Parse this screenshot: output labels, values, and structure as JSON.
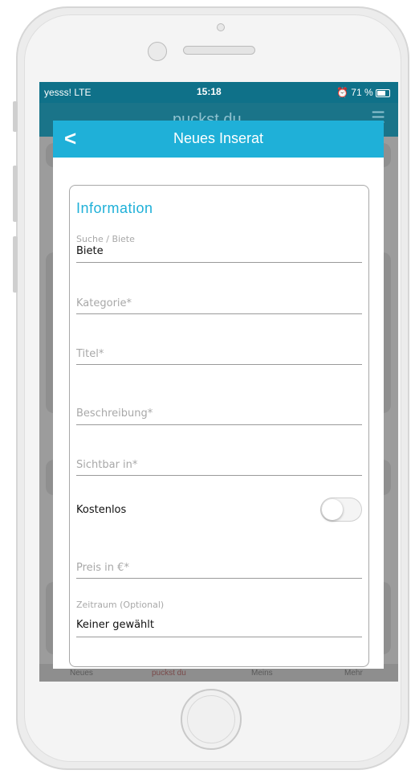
{
  "status_bar": {
    "carrier": "yesss!  LTE",
    "time": "15:18",
    "battery": "71 %"
  },
  "app_bar": {
    "title": "puckst du"
  },
  "modal": {
    "title": "Neues Inserat",
    "section_title": "Information",
    "fields": {
      "suche_biete": {
        "label": "Suche / Biete",
        "value": "Biete"
      },
      "kategorie": {
        "placeholder": "Kategorie*"
      },
      "titel": {
        "placeholder": "Titel*"
      },
      "beschreibung": {
        "placeholder": "Beschreibung*"
      },
      "sichtbar": {
        "placeholder": "Sichtbar in*"
      },
      "kostenlos": {
        "label": "Kostenlos",
        "on": false
      },
      "preis": {
        "placeholder": "Preis in €*"
      },
      "zeitraum": {
        "label": "Zeitraum (Optional)",
        "value": "Keiner gewählt"
      }
    }
  },
  "bottom_tabs": [
    "Neues",
    "puckst du",
    "Meins",
    "Mehr"
  ],
  "colors": {
    "accent": "#1fb0d8",
    "status_bar": "#0f7189",
    "overlay": "#9c9c9c"
  }
}
